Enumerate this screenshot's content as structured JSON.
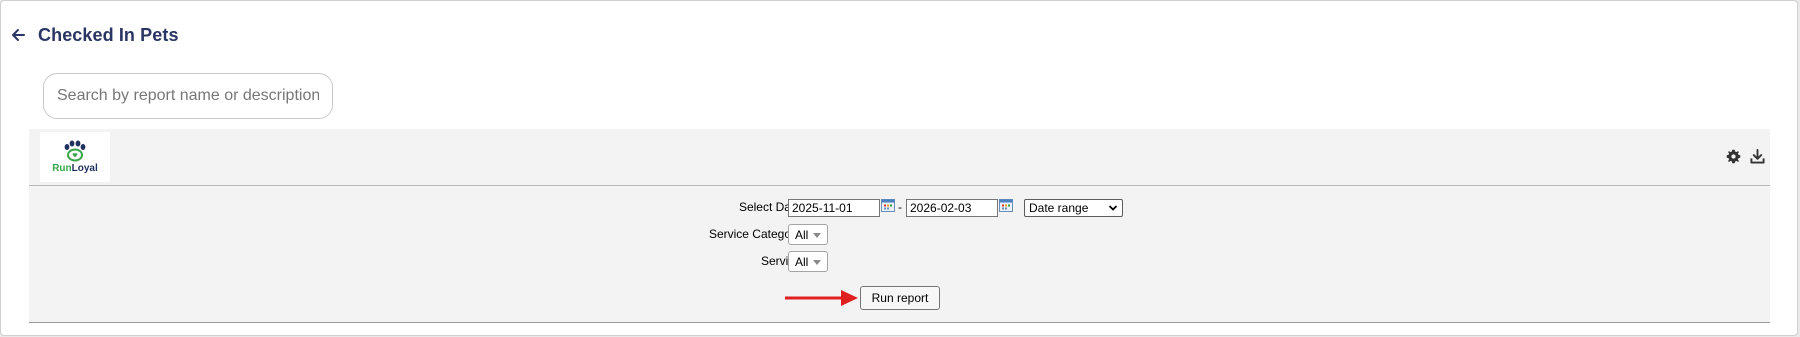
{
  "header": {
    "title": "Checked In Pets"
  },
  "search": {
    "placeholder": "Search by report name or description",
    "value": ""
  },
  "toolbar": {
    "logo": {
      "text_run": "Run",
      "text_loyal": "Loyal",
      "icon": "paw-heart-icon"
    },
    "icons": [
      "gear-icon",
      "download-icon"
    ]
  },
  "params": {
    "select_date": {
      "label": "Select Date",
      "start": "2025-11-01",
      "separator": "-",
      "end": "2026-02-03",
      "range_option": "Date range"
    },
    "service_category": {
      "label": "Service Category",
      "value": "All"
    },
    "service": {
      "label": "Service",
      "value": "All"
    },
    "run_button": "Run report"
  },
  "colors": {
    "title": "#2a3563",
    "panel_bg": "#f3f3f3",
    "arrow": "#e02020",
    "logo_green": "#38a54b",
    "logo_navy": "#1f2f5e"
  }
}
